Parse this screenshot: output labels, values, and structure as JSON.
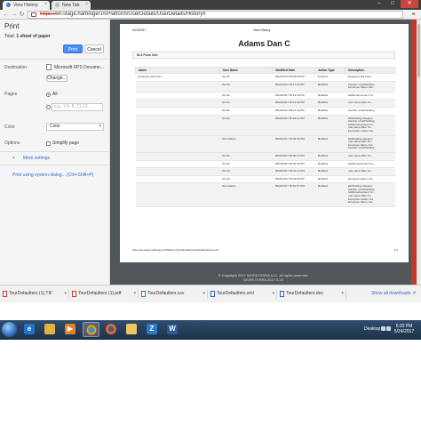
{
  "browser": {
    "tabs": [
      {
        "title": "View History",
        "close": "×"
      },
      {
        "title": "New Tab",
        "close": "×"
      }
    ],
    "window_controls": {
      "minimize": "–",
      "maximize": "□",
      "close": "✕"
    },
    "nav": {
      "back": "←",
      "forward": "→",
      "reload": "↻"
    },
    "url": {
      "scheme": "https://",
      "rest": "wt-stage.harbinger.in/Platform/UserDetails/UserDetails/History#"
    },
    "menu_glyph": "≡"
  },
  "print_panel": {
    "title": "Print",
    "total_label": "Total:",
    "total_value": "1 sheet of paper",
    "print_button": "Print",
    "cancel_button": "Cancel",
    "destination_label": "Destination",
    "destination_value": "Microsoft XPS Docume...",
    "change_button": "Change...",
    "pages_label": "Pages",
    "pages_all": "All",
    "pages_custom_placeholder": "e.g. 1-5, 8, 11-13",
    "color_label": "Color",
    "color_value": "Color",
    "options_label": "Options",
    "simplify_label": "Simplify page",
    "more_settings": "More settings",
    "system_dialog_link": "Print using system dialog... (Ctrl+Shift+P)"
  },
  "preview_page": {
    "date": "5/24/2017",
    "header_title": "View History",
    "user_name": "Adams Dan C",
    "section_title": "W-4 Form Info",
    "columns": [
      "Name",
      "User Name",
      "Modified Date",
      "Action Type",
      "Description"
    ],
    "rows": [
      {
        "name": "Employee W4 Form",
        "user": "SA SA",
        "date": "05/24/2017 05:25:58 PM",
        "action": "Inserted",
        "desc": [
          "Employee W4 Form"
        ]
      },
      {
        "name": "",
        "user": "SA SA",
        "date": "05/24/2017 05:17:00 PM",
        "action": "Modified",
        "desc": [
          "Number of withholding",
          "Employee Name Yali..."
        ]
      },
      {
        "name": "",
        "user": "SA SA",
        "date": "05/24/2017 05:23:39 PM",
        "action": "Modified",
        "desc": [
          "Additional amount Yo..."
        ]
      },
      {
        "name": "",
        "user": "SA SA",
        "date": "05/24/2017 05:21:32 PM",
        "action": "Modified",
        "desc": [
          "Last name differ fro..."
        ]
      },
      {
        "name": "",
        "user": "SA SA",
        "date": "05/24/2017 05:21:44 PM",
        "action": "Modified",
        "desc": [
          "Number of withholding"
        ]
      },
      {
        "name": "",
        "user": "SA SA",
        "date": "05/24/2017 05:18:12 PM",
        "action": "Modified",
        "desc": [
          "Withholding category",
          "Number of withholding",
          "Additional amount Yo...",
          "Last name differ fro...",
          "Exemption status Yes"
        ]
      },
      {
        "name": "",
        "user": "Dan Adams",
        "date": "05/24/2017 05:09:32 PM",
        "action": "Modified",
        "desc": [
          "Withholding category",
          "Last name differ fro...",
          "Employee Name Yes",
          "Number of withholding"
        ]
      },
      {
        "name": "",
        "user": "SA SA",
        "date": "05/24/2017 05:46:10 PM",
        "action": "Modified",
        "desc": [
          "Last name differ fro..."
        ]
      },
      {
        "name": "",
        "user": "SA SA",
        "date": "05/24/2017 05:40:33 PM",
        "action": "Modified",
        "desc": [
          "Additional amount Yo..."
        ]
      },
      {
        "name": "",
        "user": "SA SA",
        "date": "05/24/2017 05:41:10 PM",
        "action": "Modified",
        "desc": [
          "Last name differ fro..."
        ]
      },
      {
        "name": "",
        "user": "SA SA",
        "date": "05/24/2017 05:43:05 PM",
        "action": "Modified",
        "desc": [
          "Employee Name Yes"
        ]
      },
      {
        "name": "",
        "user": "Dan Adams",
        "date": "05/24/2017 05:10:57 PM",
        "action": "Modified",
        "desc": [
          "Withholding category",
          "Number of withholding",
          "Additional amount Yo...",
          "Last name differ fro...",
          "Exemption status Yes",
          "Employee Name Yes"
        ]
      }
    ],
    "footer_url": "https://wt-stage.harbinger.in/Platform/UserDetails/UserDetails/History.pdf",
    "footer_page": "1/1"
  },
  "copyright": [
    "© Copyright 2017 WORKTERRA LLC. All rights reserved.",
    "WORKTERRA 2017.5.24"
  ],
  "downloads": {
    "items": [
      {
        "label": "TourDefaulters (1).TIF",
        "color": "red"
      },
      {
        "label": "TourDefaulters (1).pdf",
        "color": "red"
      },
      {
        "label": "TourDefaulters.csv",
        "color": "green"
      },
      {
        "label": "TourDefaulters.xml",
        "color": "blue"
      },
      {
        "label": "TourDefaulters.doc",
        "color": "blue"
      }
    ],
    "chevron": "▾",
    "show_all": "Show all downloads...",
    "close": "×"
  },
  "taskbar": {
    "apps": [
      "IE",
      "Files",
      "Media",
      "Chrome",
      "Firefox",
      "Folder",
      "Z",
      "Word"
    ],
    "desktop_label": "Desktop",
    "time": "6:20 PM",
    "date": "5/24/2017"
  },
  "colors": {
    "accent_blue": "#4a8af4",
    "preview_bg": "#525659",
    "taskbar": "#2f4d6e"
  }
}
